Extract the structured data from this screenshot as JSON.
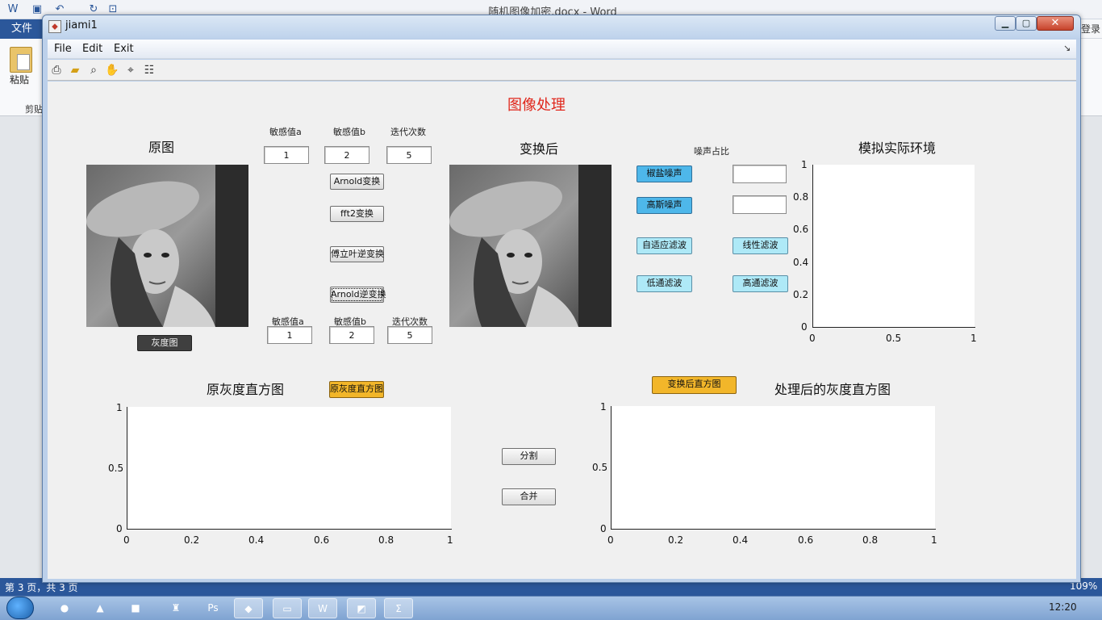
{
  "word": {
    "title": "随机图像加密.docx - Word",
    "file_tab": "文件",
    "login": "登录",
    "paste_label": "粘贴",
    "clipboard_label": "剪贴",
    "status_left": "第 3 页，共 3 页",
    "zoom": "109%"
  },
  "taskbar": {
    "clock": "12:20",
    "items": [
      "chrome",
      "acrobat",
      "office",
      "network",
      "photoshop",
      "matlab",
      "explorer",
      "word",
      "paint",
      "mathtype"
    ]
  },
  "figure": {
    "title": "jiami1",
    "menus": [
      "File",
      "Edit",
      "Exit"
    ],
    "toolbar_icons": [
      "print-icon",
      "open-folder-icon",
      "zoom-icon",
      "pan-hand-icon",
      "data-cursor-icon",
      "legend-icon"
    ],
    "main_title": "图像处理",
    "original": {
      "title": "原图",
      "gray_button": "灰度图"
    },
    "params_top": {
      "labels": [
        "敏感值a",
        "敏感值b",
        "迭代次数"
      ],
      "values": [
        "1",
        "2",
        "5"
      ]
    },
    "params_bottom": {
      "labels": [
        "敏感值a",
        "敏感值b",
        "迭代次数"
      ],
      "values": [
        "1",
        "2",
        "5"
      ]
    },
    "buttons": {
      "arnold": "Arnold变换",
      "fft2": "fft2变换",
      "ifft": "傅立叶逆变换",
      "arnold_inverse": "Arnold逆变换",
      "salt_pepper": "椒盐噪声",
      "gaussian": "高斯噪声",
      "adaptive_filter": "自适应滤波",
      "linear_filter": "线性滤波",
      "lowpass": "低通滤波",
      "highpass": "高通滤波",
      "orig_hist": "原灰度直方图",
      "trans_hist": "变换后直方图",
      "split": "分割",
      "merge": "合并"
    },
    "transformed": {
      "title": "变换后"
    },
    "noise_ratio_label": "噪声占比",
    "noise_inputs": [
      "",
      ""
    ],
    "env": {
      "title": "模拟实际环境",
      "y_ticks": [
        "0",
        "0.2",
        "0.4",
        "0.6",
        "0.8",
        "1"
      ],
      "x_ticks": [
        "0",
        "0.5",
        "1"
      ]
    },
    "orig_hist_axes": {
      "title": "原灰度直方图",
      "y_ticks": [
        "0",
        "0.5",
        "1"
      ],
      "x_ticks": [
        "0",
        "0.2",
        "0.4",
        "0.6",
        "0.8",
        "1"
      ]
    },
    "processed_hist_axes": {
      "title": "处理后的灰度直方图",
      "y_ticks": [
        "0",
        "0.5",
        "1"
      ],
      "x_ticks": [
        "0",
        "0.2",
        "0.4",
        "0.6",
        "0.8",
        "1"
      ]
    }
  }
}
